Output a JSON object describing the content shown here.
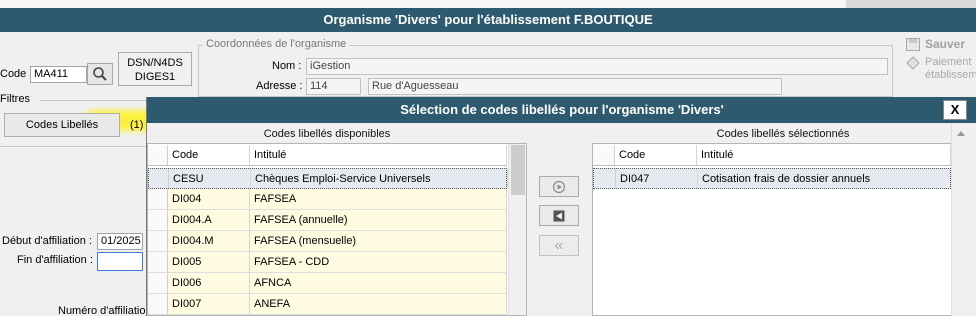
{
  "main": {
    "title": "Organisme 'Divers' pour l'établissement F.BOUTIQUE",
    "code_label": "Code :",
    "code_value": "MA411",
    "dsn_label": "DSN/N4DS",
    "dsn_value": "DIGES1",
    "coordonnees_title": "Coordonnées de l'organisme",
    "nom_label": "Nom :",
    "nom_value": "iGestion",
    "adresse_label": "Adresse :",
    "adresse_num": "114",
    "adresse_rue": "Rue d'Aguesseau",
    "filtres_label": "Filtres",
    "codes_libelles_button": "Codes Libellés",
    "codes_libelles_count": "(1)",
    "debut_label": "Début d'affiliation :",
    "debut_value": "01/2025",
    "fin_label": "Fin d'affiliation :",
    "fin_value": "",
    "numero_label": "Numéro d'affiliatio",
    "sauver_label": "Sauver",
    "paiement_label_1": "Paiement",
    "paiement_label_2": "établissem"
  },
  "dialog": {
    "title": "Sélection de codes libellés pour l'organisme 'Divers'",
    "close_label": "X",
    "available": {
      "header": "Codes libellés disponibles",
      "columns": [
        "Code",
        "Intitulé"
      ],
      "rows": [
        {
          "code": "CESU",
          "label": "Chèques Emploi-Service Universels"
        },
        {
          "code": "DI004",
          "label": "FAFSEA"
        },
        {
          "code": "DI004.A",
          "label": "FAFSEA (annuelle)"
        },
        {
          "code": "DI004.M",
          "label": "FAFSEA (mensuelle)"
        },
        {
          "code": "DI005",
          "label": "FAFSEA - CDD"
        },
        {
          "code": "DI006",
          "label": "AFNCA"
        },
        {
          "code": "DI007",
          "label": "ANEFA"
        }
      ]
    },
    "selected": {
      "header": "Codes libellés sélectionnés",
      "columns": [
        "Code",
        "Intitulé"
      ],
      "rows": [
        {
          "code": "DI047",
          "label": "Cotisation frais de dossier annuels"
        }
      ]
    },
    "move_buttons": {
      "add_one": "›",
      "remove_one": "‹",
      "remove_all": "«"
    }
  }
}
